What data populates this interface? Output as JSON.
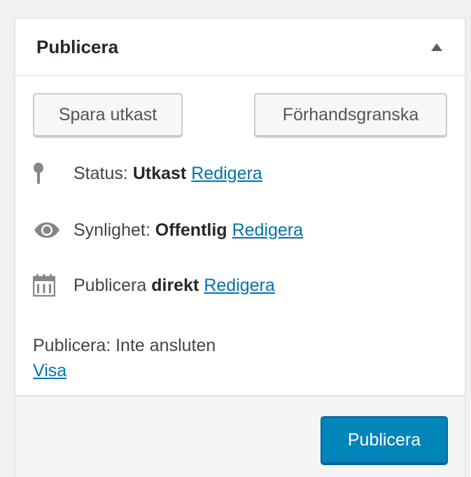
{
  "panel": {
    "title": "Publicera",
    "toggle_icon": "triangle-up-icon"
  },
  "buttons": {
    "save_draft": "Spara utkast",
    "preview": "Förhandsgranska",
    "publish": "Publicera"
  },
  "status": {
    "icon": "pin-icon",
    "label": "Status:",
    "value": "Utkast",
    "edit_link": "Redigera"
  },
  "visibility": {
    "icon": "eye-icon",
    "label": "Synlighet:",
    "value": "Offentlig",
    "edit_link": "Redigera"
  },
  "schedule": {
    "icon": "calendar-icon",
    "label": "Publicera",
    "value": "direkt",
    "edit_link": "Redigera"
  },
  "revision": {
    "text": "Publicera: Inte ansluten",
    "link": "Visa"
  },
  "colors": {
    "primary": "#0085ba",
    "link": "#0073aa",
    "text": "#23282d"
  }
}
